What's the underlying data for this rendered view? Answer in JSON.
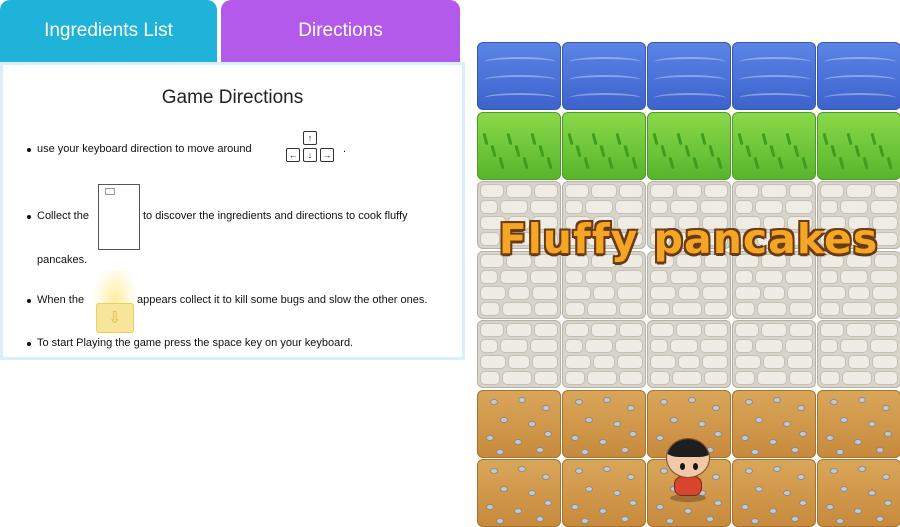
{
  "tabs": {
    "ingredients_label": "Ingredients List",
    "directions_label": "Directions"
  },
  "directions": {
    "title": "Game Directions",
    "items": [
      "use your keyboard direction to move around",
      "Collect the",
      "to discover the ingredients and directions to cook fluffy",
      "pancakes.",
      "When the",
      "appears collect it to kill some bugs and slow the other ones.",
      "To start Playing the game press the space key on your keyboard."
    ],
    "trailing_dot": ".",
    "arrow_keys": {
      "up": "↑",
      "left": "←",
      "down": "↓",
      "right": "→"
    },
    "icons": [
      "arrow-keys-icon",
      "recipe-card-icon",
      "glowing-powerup-icon"
    ]
  },
  "game": {
    "title": "Fluffy pancakes",
    "rows": [
      "water",
      "grass",
      "stone",
      "stone",
      "stone",
      "dirt",
      "dirt"
    ],
    "columns": 5,
    "colors": {
      "water": "#4a72d8",
      "grass": "#6cc63a",
      "stone": "#e3dfd7",
      "dirt": "#cf9648",
      "title": "#f5a624",
      "title_outline": "#6a3a12"
    }
  },
  "colors": {
    "tab_ingredients": "#1fb3da",
    "tab_directions": "#b45aeb",
    "panel_border": "#dbeefc"
  }
}
